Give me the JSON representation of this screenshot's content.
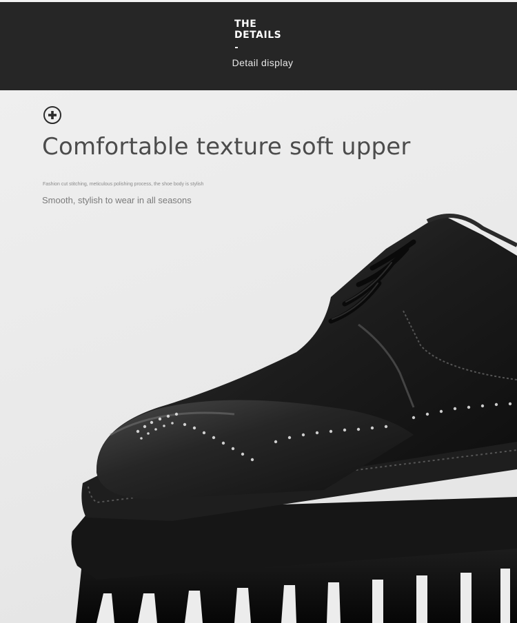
{
  "header": {
    "title_line1": "THE",
    "title_line2": "DETAILS",
    "subtitle": "Detail display"
  },
  "section": {
    "icon": "plus-circle-icon",
    "heading": "Comfortable texture soft upper",
    "small_description": "Fashion cut stitching, meticulous polishing process, the shoe body is stylish",
    "description": "Smooth, stylish to wear in all seasons"
  },
  "image": {
    "subject": "shoe-photo"
  },
  "colors": {
    "header_bg": "#262626",
    "page_bg": "#ececec",
    "heading_text": "#4c4c4c"
  }
}
